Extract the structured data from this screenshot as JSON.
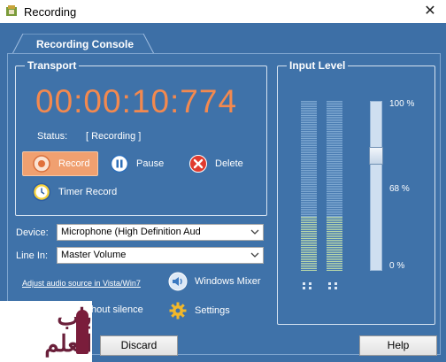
{
  "window": {
    "title": "Recording",
    "close_glyph": "✕"
  },
  "tab": {
    "label": "Recording Console"
  },
  "transport": {
    "legend": "Transport",
    "timer": "00:00:10:774",
    "status_label": "Status:",
    "status_value": "[ Recording ]",
    "record_label": "Record",
    "pause_label": "Pause",
    "delete_label": "Delete",
    "timer_record_label": "Timer Record"
  },
  "device": {
    "label": "Device:",
    "value": "Microphone (High Definition Aud"
  },
  "line_in": {
    "label": "Line In:",
    "value": "Master Volume"
  },
  "options": {
    "adjust_link": "Adjust audio source in Vista/Win7",
    "windows_mixer": "Windows Mixer",
    "silence_partial": "thout silence",
    "settings": "Settings"
  },
  "input_level": {
    "legend": "Input Level",
    "tick_100": "100 %",
    "tick_68": "68 %",
    "tick_0": "0 %",
    "left_level": 0.32,
    "right_level": 0.32,
    "slider_value": 0.72
  },
  "footer": {
    "discard": "Discard",
    "help": "Help"
  },
  "watermark": {
    "text": "باب العلم"
  },
  "colors": {
    "accent": "#3d6fa6",
    "timer": "#f3894f",
    "record_button": "#f0a070"
  }
}
